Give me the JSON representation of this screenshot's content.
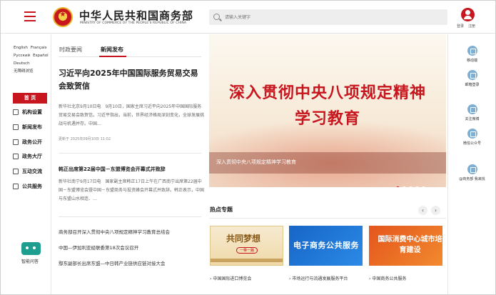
{
  "header": {
    "site_name": "中华人民共和国商务部",
    "site_name_en": "MINISTRY OF COMMERCE OF THE PEOPLE'S REPUBLIC OF CHINA",
    "search_placeholder": "请输入关键字",
    "login": "登录",
    "register": "注册"
  },
  "languages": [
    "English",
    "Français",
    "Русский",
    "Español",
    "Deutsch",
    "无障碍浏览"
  ],
  "nav": {
    "home": "首 页",
    "items": [
      "机构设置",
      "新闻发布",
      "政务公开",
      "政务大厅",
      "互动交流",
      "公共服务"
    ],
    "ai_label": "智能问答"
  },
  "news": {
    "tabs": [
      "时政要闻",
      "新闻发布"
    ],
    "active_tab": "新闻发布",
    "lead": {
      "title": "习近平向2025年中国国际服务贸易交易会致贺信",
      "summary": "新华社北京9月10日电　9月10日，国家主席习近平向2025年中国国际服务贸易交易会致贺信。习近平指出，当前，世界经济格局深刻变化，全球发展挑战与机遇并存。中国…",
      "date": "更新于 2025年09月10日 11:02"
    },
    "second": {
      "title": "韩正出席第22届中国－东盟博览会开幕式并致辞",
      "summary": "新华社南宁9月17日电　国家副主席韩正17日上午在广西南宁出席第22届中国－东盟博览会暨中国－东盟商务与投资峰会开幕式并致辞。韩正表示，中国与东盟山水相连、…"
    },
    "links": [
      "商务部召开深入贯彻中央八项规定精神学习教育总结会",
      "中国—伊加利亚经联委第18次会议召开",
      "鄢东副部长出席东盟—中日韩产业链供应链对接大会"
    ]
  },
  "banner": {
    "line1": "深入贯彻中央八项规定精神",
    "line2": "学习教育",
    "caption": "深入贯彻中央八项规定精神学习教育",
    "dots": 5,
    "active_dot": 1
  },
  "hot": {
    "title": "热点专题",
    "prev": "‹",
    "next": "›",
    "cards": [
      {
        "title": "共同梦想",
        "subtitle": "一带一路",
        "caption": "中国国际进口博览会"
      },
      {
        "title": "电子商务公共服务",
        "caption": "市场运行与流通发展服务平台"
      },
      {
        "title": "国际消费中心城市培育建设",
        "caption": "中国商务公共服务"
      }
    ]
  },
  "tools": [
    "移动端",
    "邮箱登录",
    "关注微博",
    "微信公众号",
    "@商务部 我来找"
  ]
}
